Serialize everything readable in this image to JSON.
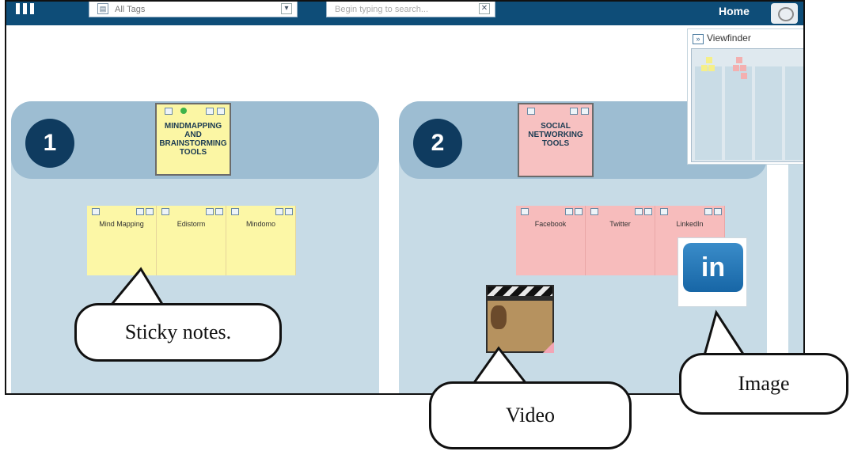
{
  "topbar": {
    "boards_field": "All Tags",
    "search_placeholder": "Begin typing to search...",
    "home_label": "Home"
  },
  "columns": [
    {
      "number": "1",
      "header": "MINDMAPPING AND BRAINSTORMING TOOLS",
      "notes": [
        "Mind Mapping",
        "Edistorm",
        "Mindomo"
      ]
    },
    {
      "number": "2",
      "header": "SOCIAL NETWORKING TOOLS",
      "notes": [
        "Facebook",
        "Twitter",
        "LinkedIn"
      ]
    }
  ],
  "viewfinder": {
    "title": "Viewfinder"
  },
  "image_item": {
    "logo_text": "in"
  },
  "callouts": {
    "sticky": "Sticky notes.",
    "video": "Video",
    "image": "Image"
  },
  "colors": {
    "topbar": "#0e4d78",
    "column_head": "#9dbdd2",
    "column_body": "#c7dbe6",
    "sticky_yellow": "#fcf7a6",
    "sticky_pink": "#f7bcbc",
    "linkedin_blue": "#1766a6"
  },
  "icons": [
    "menu-icon",
    "tags-icon",
    "clear-icon",
    "avatar",
    "expand-icon",
    "linkedin-logo"
  ]
}
